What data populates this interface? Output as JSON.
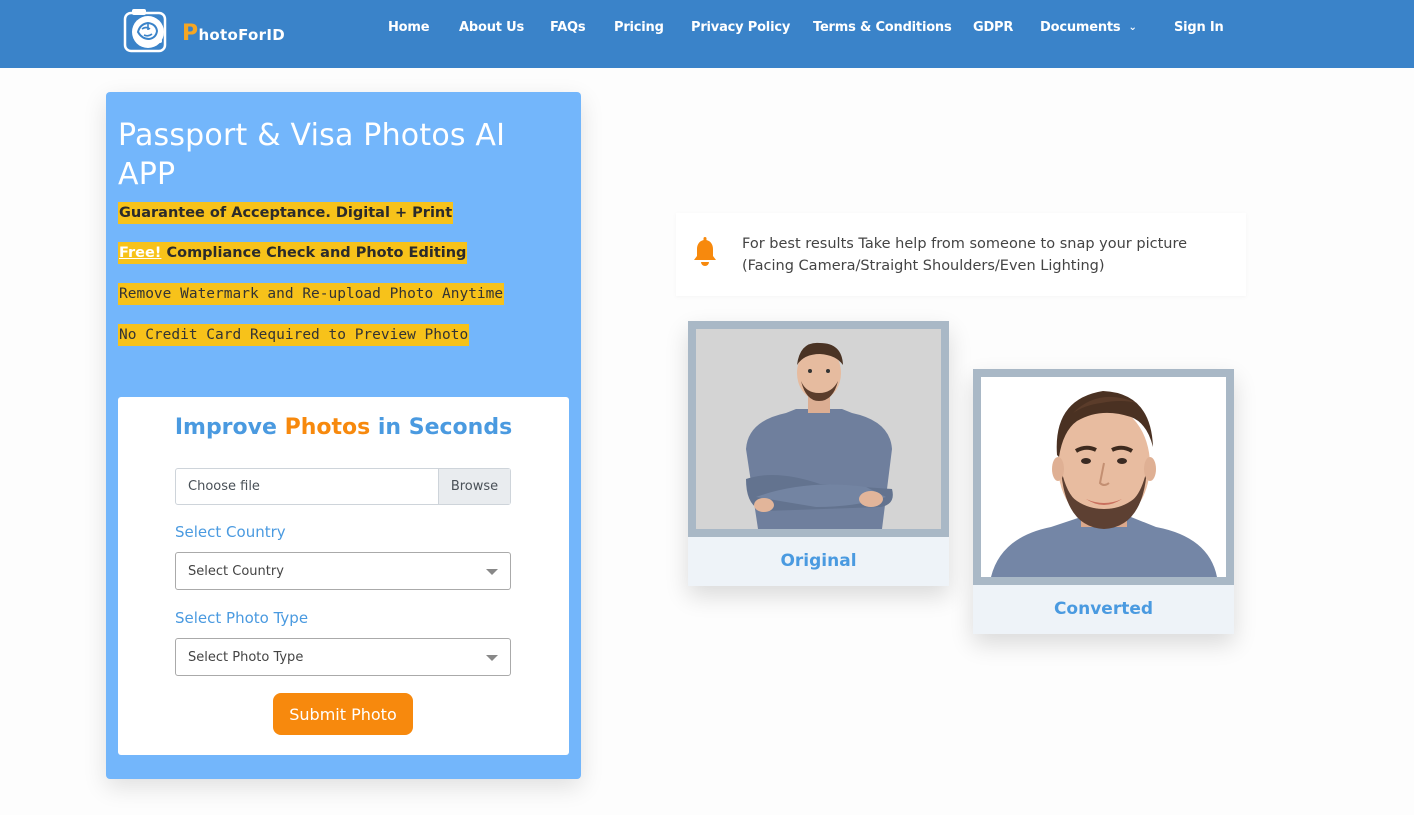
{
  "brand": {
    "name": "PhotoForID",
    "name_rest": "hotoForID",
    "name_initial": "P"
  },
  "nav": {
    "items": [
      {
        "id": "home",
        "label": "Home"
      },
      {
        "id": "about",
        "label": "About Us"
      },
      {
        "id": "faqs",
        "label": "FAQs"
      },
      {
        "id": "pricing",
        "label": "Pricing"
      },
      {
        "id": "privacy",
        "label": "Privacy Policy"
      },
      {
        "id": "terms",
        "label": "Terms & Conditions"
      },
      {
        "id": "gdpr",
        "label": "GDPR"
      },
      {
        "id": "documents",
        "label": "Documents"
      },
      {
        "id": "signin",
        "label": "Sign In"
      }
    ]
  },
  "hero": {
    "title": "Passport & Visa Photos AI APP",
    "guarantee": "Guarantee of Acceptance. Digital + Print",
    "free_link": "Free!",
    "free_text": " Compliance Check and Photo Editing",
    "watermark": "Remove Watermark and Re-upload Photo Anytime",
    "no_card": "No Credit Card Required to Preview Photo"
  },
  "form": {
    "title_part1": "Improve ",
    "title_part2": "Photos",
    "title_part3": " in Seconds",
    "file_placeholder": "Choose file",
    "browse_label": "Browse",
    "country_label": "Select Country",
    "country_value": "Select Country",
    "type_label": "Select Photo Type",
    "type_value": "Select Photo Type",
    "submit_label": "Submit Photo"
  },
  "tip": {
    "text": "For best results Take help from someone to snap your picture (Facing Camera/Straight Shoulders/Even Lighting)"
  },
  "photos": {
    "original_caption": "Original",
    "converted_caption": "Converted"
  },
  "colors": {
    "header": "#3a83c9",
    "hero": "#73b6fb",
    "accent_orange": "#f7890d",
    "highlight": "#f7c21a",
    "label_blue": "#4a9ae0"
  }
}
